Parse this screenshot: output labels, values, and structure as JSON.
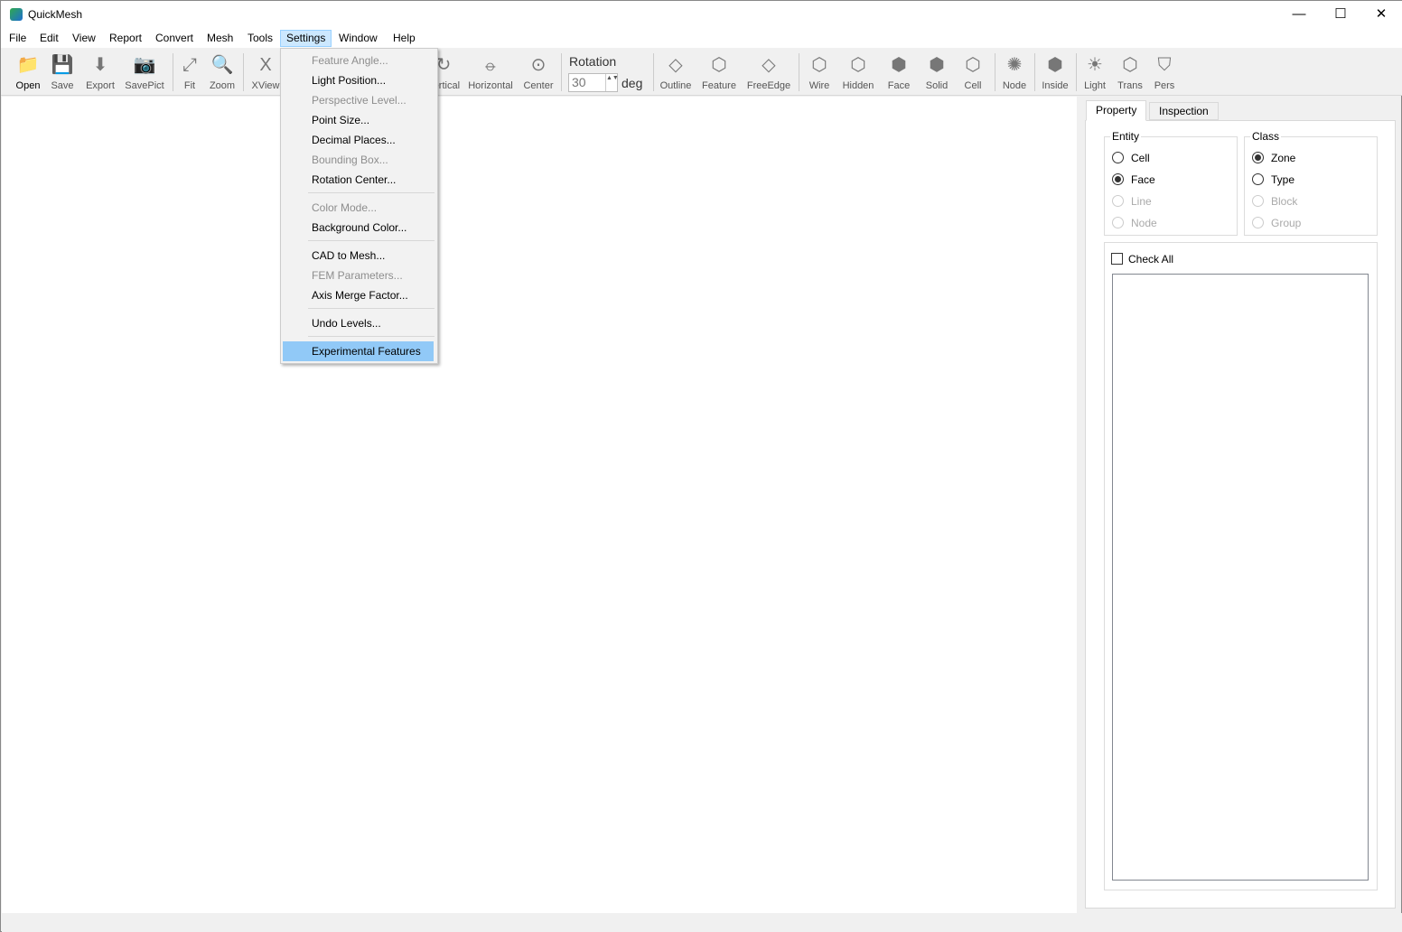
{
  "window": {
    "title": "QuickMesh",
    "controls": [
      "—",
      "☐",
      "✕"
    ]
  },
  "menubar": [
    "File",
    "Edit",
    "View",
    "Report",
    "Convert",
    "Mesh",
    "Tools",
    "Settings",
    "Window",
    "Help"
  ],
  "toolbar": {
    "buttons": [
      {
        "label": "Open",
        "icon": "folder-icon",
        "glyph": "📁"
      },
      {
        "label": "Save",
        "icon": "floppy-icon",
        "glyph": "💾"
      },
      {
        "label": "Export",
        "icon": "download-icon",
        "glyph": "⬇"
      },
      {
        "label": "SavePict",
        "icon": "camera-icon",
        "glyph": "📷"
      },
      {
        "label": "Fit",
        "icon": "fit-icon",
        "glyph": "⤢"
      },
      {
        "label": "Zoom",
        "icon": "zoom-icon",
        "glyph": "🔍"
      },
      {
        "label": "XView",
        "icon": "x-axis-icon",
        "glyph": "X"
      },
      {
        "label": "Vertical",
        "icon": "vertical-rotate-icon",
        "glyph": "↻"
      },
      {
        "label": "Horizontal",
        "icon": "horizontal-rotate-icon",
        "glyph": "⦵"
      },
      {
        "label": "Center",
        "icon": "center-icon",
        "glyph": "⊙"
      },
      {
        "label": "Outline",
        "icon": "outline-icon",
        "glyph": "◇"
      },
      {
        "label": "Feature",
        "icon": "feature-cube-icon",
        "glyph": "⬡"
      },
      {
        "label": "FreeEdge",
        "icon": "free-edge-icon",
        "glyph": "◇"
      },
      {
        "label": "Wire",
        "icon": "wire-cube-icon",
        "glyph": "⬡"
      },
      {
        "label": "Hidden",
        "icon": "hidden-cube-icon",
        "glyph": "⬡"
      },
      {
        "label": "Face",
        "icon": "face-cube-icon",
        "glyph": "⬢"
      },
      {
        "label": "Solid",
        "icon": "solid-cube-icon",
        "glyph": "⬢"
      },
      {
        "label": "Cell",
        "icon": "cell-mesh-icon",
        "glyph": "⬡"
      },
      {
        "label": "Node",
        "icon": "node-icon",
        "glyph": "✺"
      },
      {
        "label": "Inside",
        "icon": "inside-icon",
        "glyph": "⬢"
      },
      {
        "label": "Light",
        "icon": "sun-icon",
        "glyph": "☀"
      },
      {
        "label": "Trans",
        "icon": "transparent-cube-icon",
        "glyph": "⬡"
      },
      {
        "label": "Pers",
        "icon": "shield-icon",
        "glyph": "⛉"
      }
    ],
    "rotation": {
      "label": "Rotation",
      "value": "30",
      "unit": "deg",
      "spin": "▲▼"
    }
  },
  "settings_menu": [
    {
      "label": "Feature Angle...",
      "enabled": false
    },
    {
      "label": "Light Position...",
      "enabled": true
    },
    {
      "label": "Perspective Level...",
      "enabled": false
    },
    {
      "label": "Point Size...",
      "enabled": true
    },
    {
      "label": "Decimal Places...",
      "enabled": true
    },
    {
      "label": "Bounding Box...",
      "enabled": false
    },
    {
      "label": "Rotation Center...",
      "enabled": true
    },
    {
      "label": "Color Mode...",
      "enabled": false
    },
    {
      "label": "Background Color...",
      "enabled": true
    },
    {
      "label": "CAD to Mesh...",
      "enabled": true
    },
    {
      "label": "FEM Parameters...",
      "enabled": false
    },
    {
      "label": "Axis Merge Factor...",
      "enabled": true
    },
    {
      "label": "Undo Levels...",
      "enabled": true
    },
    {
      "label": "Experimental Features",
      "enabled": true,
      "highlighted": true
    }
  ],
  "panel": {
    "tabs": [
      "Property",
      "Inspection"
    ],
    "entity": {
      "label": "Entity",
      "options": [
        {
          "label": "Cell",
          "checked": false,
          "enabled": true
        },
        {
          "label": "Face",
          "checked": true,
          "enabled": true
        },
        {
          "label": "Line",
          "checked": false,
          "enabled": false
        },
        {
          "label": "Node",
          "checked": false,
          "enabled": false
        }
      ]
    },
    "class": {
      "label": "Class",
      "options": [
        {
          "label": "Zone",
          "checked": true,
          "enabled": true
        },
        {
          "label": "Type",
          "checked": false,
          "enabled": true
        },
        {
          "label": "Block",
          "checked": false,
          "enabled": false
        },
        {
          "label": "Group",
          "checked": false,
          "enabled": false
        }
      ]
    },
    "check_all": "Check All"
  }
}
